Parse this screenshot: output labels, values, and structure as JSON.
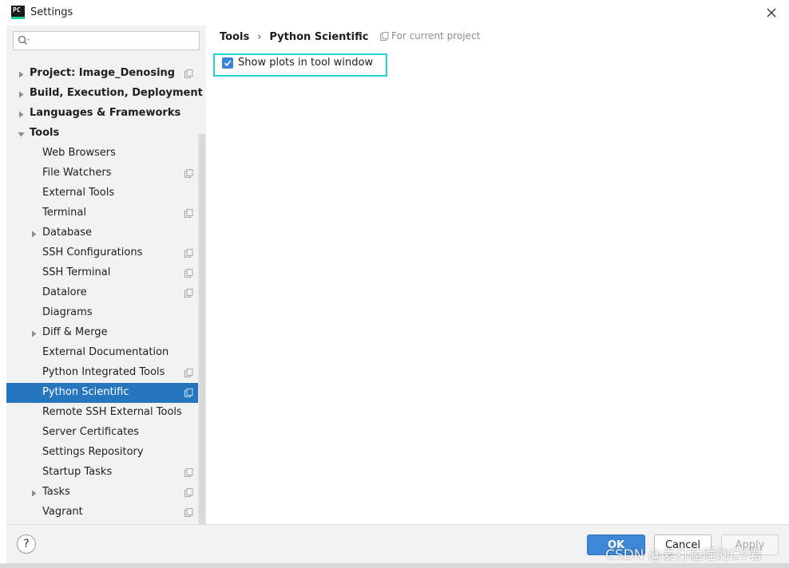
{
  "window": {
    "title": "Settings",
    "app_icon_text": "PC"
  },
  "sidebar": {
    "search": {
      "value": "",
      "placeholder": ""
    },
    "items": [
      {
        "label": "Project: Image_Denosing",
        "level": 0,
        "expandable": true,
        "expanded": false,
        "bold": true,
        "project_icon": true
      },
      {
        "label": "Build, Execution, Deployment",
        "level": 0,
        "expandable": true,
        "expanded": false,
        "bold": true,
        "project_icon": false
      },
      {
        "label": "Languages & Frameworks",
        "level": 0,
        "expandable": true,
        "expanded": false,
        "bold": true,
        "project_icon": false
      },
      {
        "label": "Tools",
        "level": 0,
        "expandable": true,
        "expanded": true,
        "bold": true,
        "project_icon": false
      },
      {
        "label": "Web Browsers",
        "level": 1,
        "expandable": false,
        "bold": false,
        "project_icon": false
      },
      {
        "label": "File Watchers",
        "level": 1,
        "expandable": false,
        "bold": false,
        "project_icon": true
      },
      {
        "label": "External Tools",
        "level": 1,
        "expandable": false,
        "bold": false,
        "project_icon": false
      },
      {
        "label": "Terminal",
        "level": 1,
        "expandable": false,
        "bold": false,
        "project_icon": true
      },
      {
        "label": "Database",
        "level": 1,
        "expandable": true,
        "expanded": false,
        "bold": false,
        "project_icon": false
      },
      {
        "label": "SSH Configurations",
        "level": 1,
        "expandable": false,
        "bold": false,
        "project_icon": true
      },
      {
        "label": "SSH Terminal",
        "level": 1,
        "expandable": false,
        "bold": false,
        "project_icon": true
      },
      {
        "label": "Datalore",
        "level": 1,
        "expandable": false,
        "bold": false,
        "project_icon": true
      },
      {
        "label": "Diagrams",
        "level": 1,
        "expandable": false,
        "bold": false,
        "project_icon": false
      },
      {
        "label": "Diff & Merge",
        "level": 1,
        "expandable": true,
        "expanded": false,
        "bold": false,
        "project_icon": false
      },
      {
        "label": "External Documentation",
        "level": 1,
        "expandable": false,
        "bold": false,
        "project_icon": false
      },
      {
        "label": "Python Integrated Tools",
        "level": 1,
        "expandable": false,
        "bold": false,
        "project_icon": true
      },
      {
        "label": "Python Scientific",
        "level": 1,
        "expandable": false,
        "bold": false,
        "project_icon": true,
        "selected": true
      },
      {
        "label": "Remote SSH External Tools",
        "level": 1,
        "expandable": false,
        "bold": false,
        "project_icon": false
      },
      {
        "label": "Server Certificates",
        "level": 1,
        "expandable": false,
        "bold": false,
        "project_icon": false
      },
      {
        "label": "Settings Repository",
        "level": 1,
        "expandable": false,
        "bold": false,
        "project_icon": false
      },
      {
        "label": "Startup Tasks",
        "level": 1,
        "expandable": false,
        "bold": false,
        "project_icon": true
      },
      {
        "label": "Tasks",
        "level": 1,
        "expandable": true,
        "expanded": false,
        "bold": false,
        "project_icon": true
      },
      {
        "label": "Vagrant",
        "level": 1,
        "expandable": false,
        "bold": false,
        "project_icon": true
      }
    ]
  },
  "content": {
    "breadcrumb": [
      "Tools",
      "Python Scientific"
    ],
    "breadcrumb_separator": "›",
    "scope_note": "For current project",
    "options": {
      "show_plots": {
        "label": "Show plots in tool window",
        "checked": true
      }
    }
  },
  "footer": {
    "help_label": "?",
    "ok_label": "OK",
    "cancel_label": "Cancel",
    "apply_label": "Apply",
    "apply_enabled": false
  },
  "watermark": "CSDN @爱打瞌睡的CV君",
  "colors": {
    "selection": "#2675bf",
    "accent": "#3e86d6",
    "highlight_outline": "#22d4d4"
  }
}
